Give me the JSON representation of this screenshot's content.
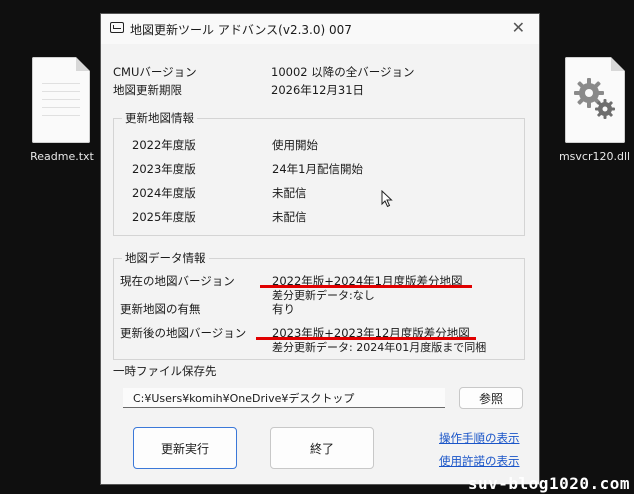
{
  "desktop": {
    "readme_label": "Readme.txt",
    "dll_label": "msvcr120.dll"
  },
  "window": {
    "title": "地図更新ツール アドバンス(v2.3.0) 007",
    "close": "✕"
  },
  "info": {
    "cmu_label": "CMUバージョン",
    "cmu_value": "10002 以降の全バージョン",
    "expire_label": "地図更新期限",
    "expire_value": "2026年12月31日"
  },
  "update_info": {
    "title": "更新地図情報",
    "rows": [
      {
        "year": "2022年度版",
        "status": "使用開始"
      },
      {
        "year": "2023年度版",
        "status": "24年1月配信開始"
      },
      {
        "year": "2024年度版",
        "status": "未配信"
      },
      {
        "year": "2025年度版",
        "status": "未配信"
      }
    ]
  },
  "map_data": {
    "title": "地図データ情報",
    "current_label": "現在の地図バージョン",
    "current_value": "2022年版+2024年1月度版差分地図",
    "current_diff": "差分更新データ:なし",
    "exists_label": "更新地図の有無",
    "exists_value": "有り",
    "after_label": "更新後の地図バージョン",
    "after_value": "2023年版+2023年12月度版差分地図",
    "after_diff": "差分更新データ: 2024年01月度版まで同梱"
  },
  "temp": {
    "label": "一時ファイル保存先",
    "path": "C:¥Users¥komih¥OneDrive¥デスクトップ",
    "browse": "参照"
  },
  "actions": {
    "run": "更新実行",
    "exit": "終了",
    "manual_link": "操作手順の表示",
    "license_link": "使用許諾の表示"
  },
  "watermark": "suv-blog1020.com",
  "colors": {
    "highlight_red": "#e00000",
    "primary_border": "#3b78d8",
    "link": "#1a55c8"
  }
}
